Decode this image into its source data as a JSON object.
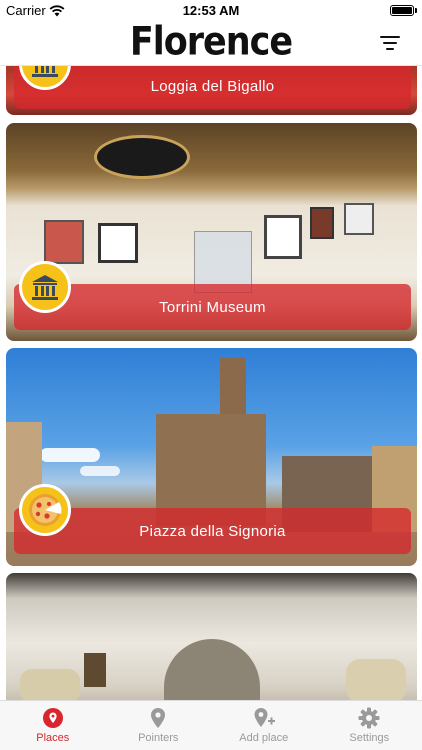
{
  "status_bar": {
    "carrier": "Carrier",
    "time": "12:53 AM"
  },
  "header": {
    "title": "Florence"
  },
  "places": [
    {
      "name": "Loggia del Bigallo",
      "category": "museum-icon"
    },
    {
      "name": "Torrini Museum",
      "category": "museum-icon"
    },
    {
      "name": "Piazza della Signoria",
      "category": "pizza-icon"
    },
    {
      "name": "",
      "category": ""
    }
  ],
  "tabs": [
    {
      "label": "Places",
      "icon": "places-icon",
      "active": true
    },
    {
      "label": "Pointers",
      "icon": "pointer-pin-icon",
      "active": false
    },
    {
      "label": "Add place",
      "icon": "add-place-icon",
      "active": false
    },
    {
      "label": "Settings",
      "icon": "gear-icon",
      "active": false
    }
  ],
  "colors": {
    "accent": "#d8262c",
    "icon_bg": "#f6c21a",
    "inactive": "#9a9a9a"
  }
}
